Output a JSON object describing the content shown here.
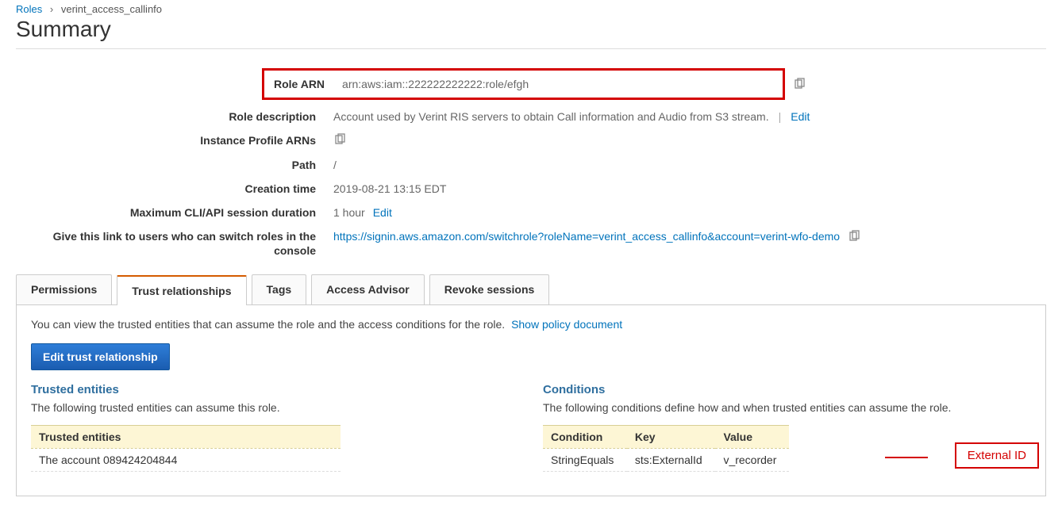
{
  "breadcrumb": {
    "roles_link": "Roles",
    "current": "verint_access_callinfo"
  },
  "page_title": "Summary",
  "summary": {
    "role_arn_label": "Role ARN",
    "role_arn_value": "arn:aws:iam::222222222222:role/efgh",
    "role_description_label": "Role description",
    "role_description_value": "Account used by Verint RIS servers to obtain Call information and Audio from S3 stream.",
    "edit_link": "Edit",
    "instance_profile_label": "Instance Profile ARNs",
    "path_label": "Path",
    "path_value": "/",
    "creation_time_label": "Creation time",
    "creation_time_value": "2019-08-21 13:15 EDT",
    "max_session_label": "Maximum CLI/API session duration",
    "max_session_value": "1 hour",
    "switch_link_label": "Give this link to users who can switch roles in the console",
    "switch_link_value": "https://signin.aws.amazon.com/switchrole?roleName=verint_access_callinfo&account=verint-wfo-demo"
  },
  "tabs": {
    "permissions": "Permissions",
    "trust": "Trust relationships",
    "tags": "Tags",
    "access_advisor": "Access Advisor",
    "revoke": "Revoke sessions"
  },
  "trust": {
    "description": "You can view the trusted entities that can assume the role and the access conditions for the role.",
    "show_policy_link": "Show policy document",
    "edit_button": "Edit trust relationship",
    "entities_heading": "Trusted entities",
    "entities_sub": "The following trusted entities can assume this role.",
    "entities_header": "Trusted entities",
    "entities_row": "The account 089424204844",
    "conditions_heading": "Conditions",
    "conditions_sub": "The following conditions define how and when trusted entities can assume the role.",
    "cond_headers": {
      "condition": "Condition",
      "key": "Key",
      "value": "Value"
    },
    "cond_row": {
      "condition": "StringEquals",
      "key": "sts:ExternalId",
      "value": "v_recorder"
    }
  },
  "annotation": {
    "external_id": "External ID"
  }
}
